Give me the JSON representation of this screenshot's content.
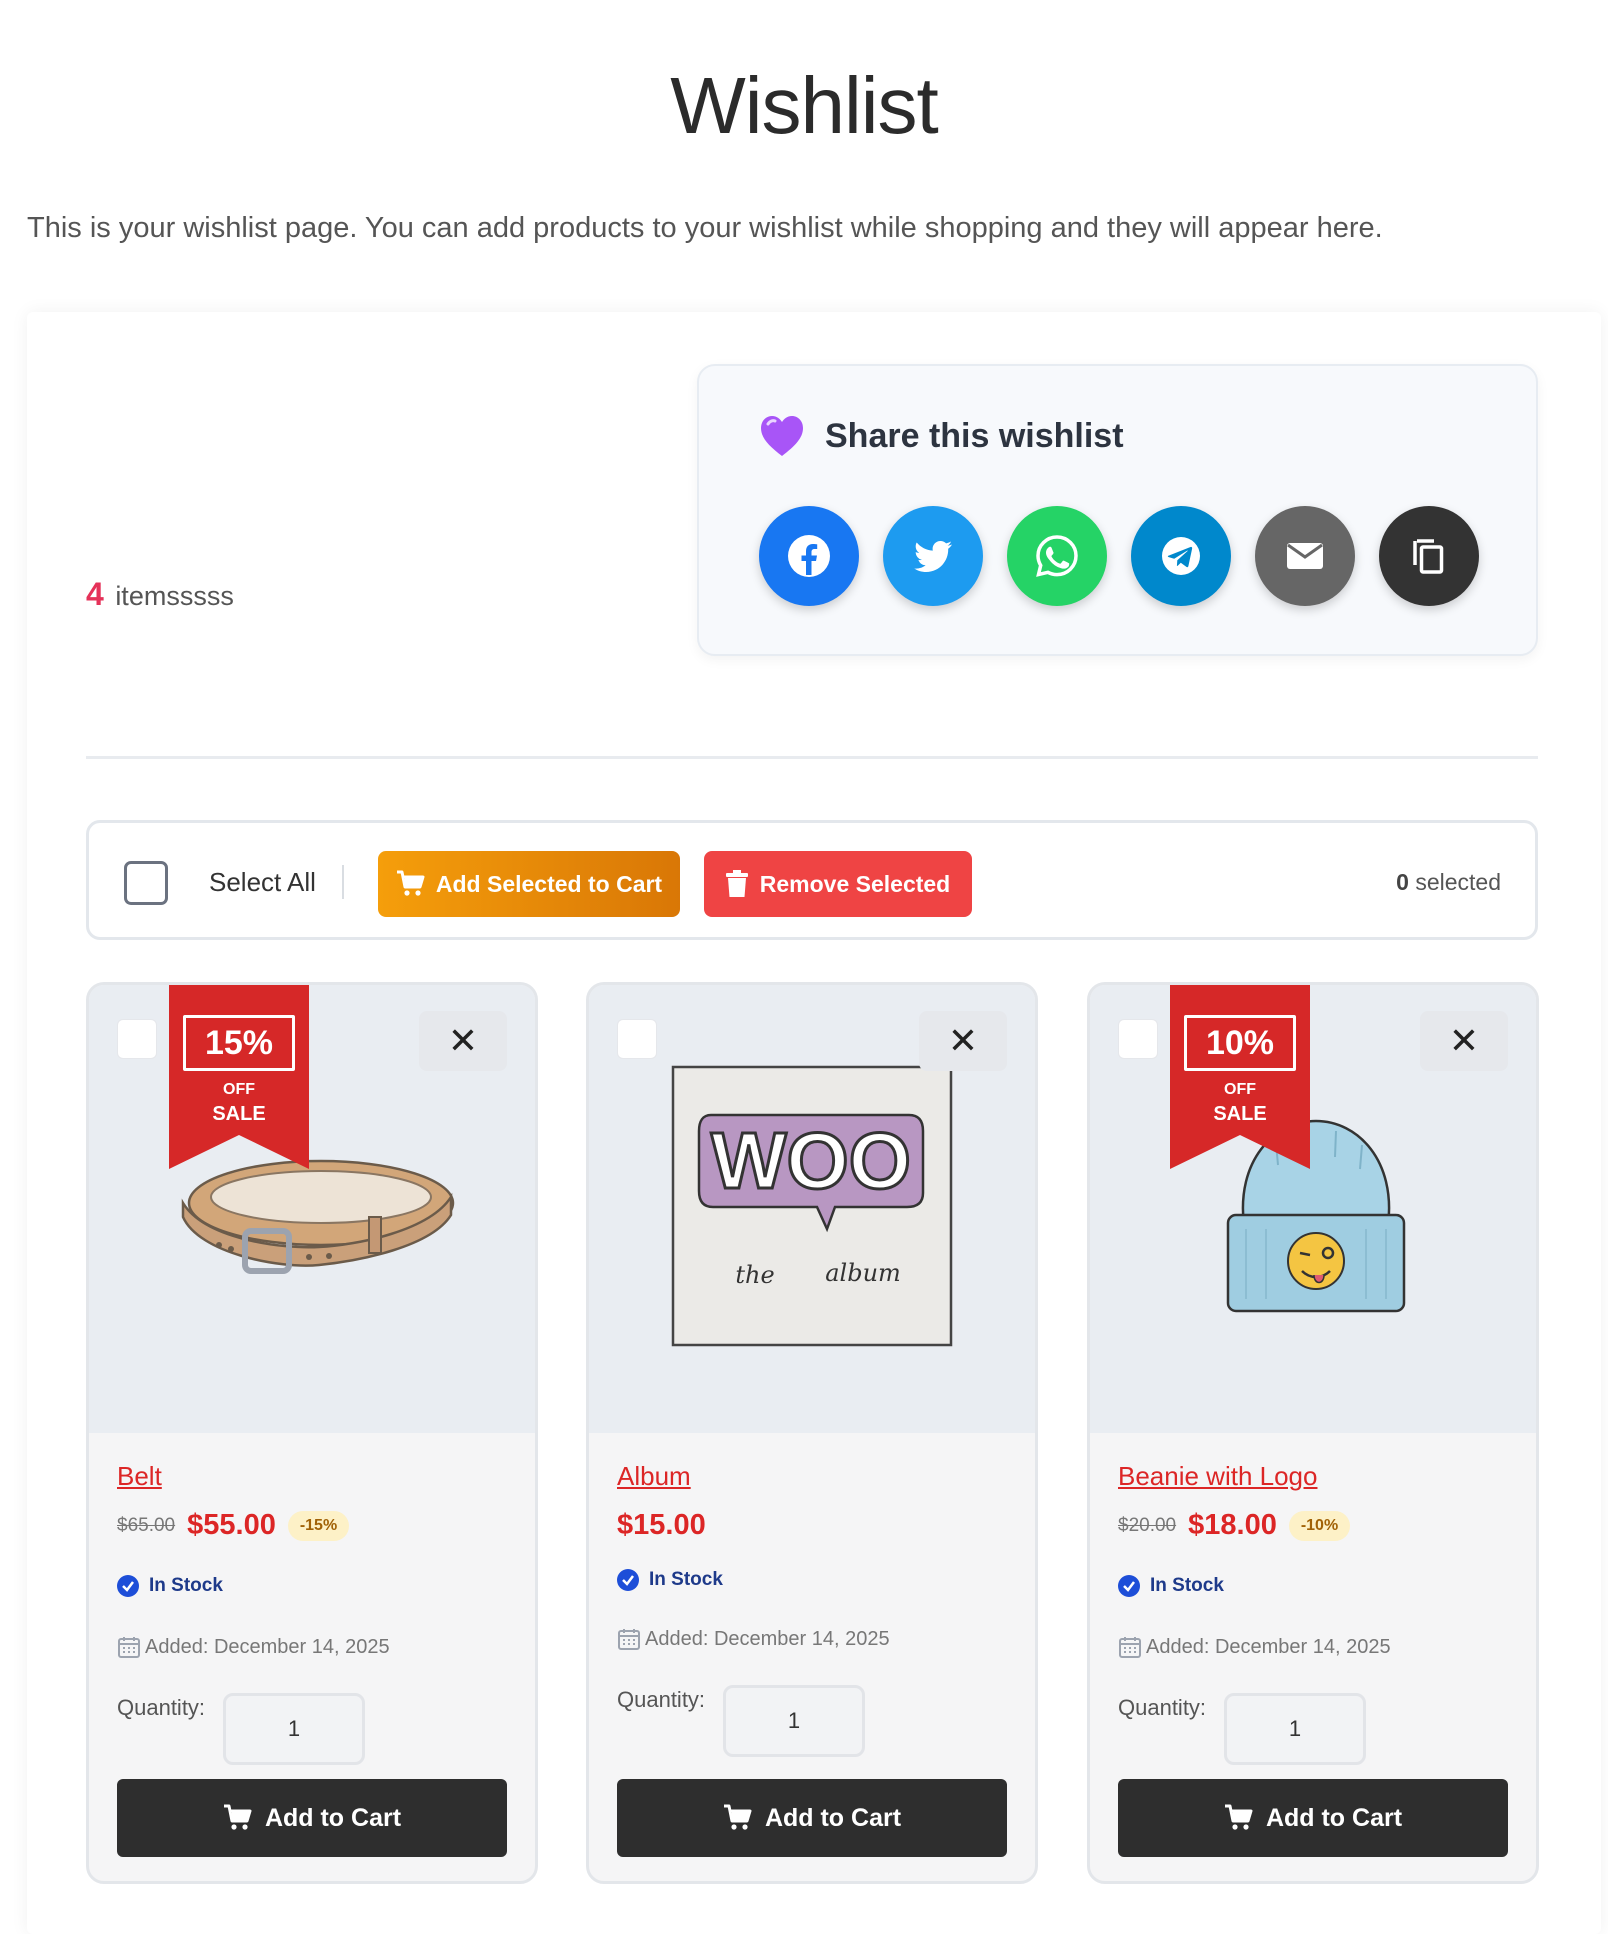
{
  "page": {
    "title": "Wishlist",
    "intro": "This is your wishlist page. You can add products to your wishlist while shopping and they will appear here."
  },
  "summary": {
    "count": "4",
    "count_label": "itemsssss"
  },
  "share": {
    "title": "Share this wishlist",
    "buttons": [
      {
        "name": "facebook",
        "icon": "facebook-icon",
        "color": "#1877f2"
      },
      {
        "name": "twitter",
        "icon": "twitter-icon",
        "color": "#1d9bf0"
      },
      {
        "name": "whatsapp",
        "icon": "whatsapp-icon",
        "color": "#25d366"
      },
      {
        "name": "telegram",
        "icon": "telegram-icon",
        "color": "#0088cc"
      },
      {
        "name": "email",
        "icon": "mail-icon",
        "color": "#666666"
      },
      {
        "name": "copy",
        "icon": "copy-icon",
        "color": "#333333"
      }
    ]
  },
  "toolbar": {
    "select_all": "Select All",
    "add_selected": "Add Selected to Cart",
    "remove_selected": "Remove Selected",
    "selected_count": "0",
    "selected_label": "selected"
  },
  "products": [
    {
      "name": "Belt",
      "old_price": "$65.00",
      "price": "$55.00",
      "discount": "-15%",
      "ribbon_pct": "15%",
      "ribbon_off": "OFF",
      "ribbon_sale": "SALE",
      "stock": "In Stock",
      "added": "Added: December 14, 2025",
      "qty_label": "Quantity:",
      "qty": "1",
      "cart_label": "Add to Cart"
    },
    {
      "name": "Album",
      "price": "$15.00",
      "stock": "In Stock",
      "added": "Added: December 14, 2025",
      "qty_label": "Quantity:",
      "qty": "1",
      "cart_label": "Add to Cart",
      "art_text_main": "WOO",
      "art_text_left": "the",
      "art_text_right": "album"
    },
    {
      "name": "Beanie with Logo",
      "old_price": "$20.00",
      "price": "$18.00",
      "discount": "-10%",
      "ribbon_pct": "10%",
      "ribbon_off": "OFF",
      "ribbon_sale": "SALE",
      "stock": "In Stock",
      "added": "Added: December 14, 2025",
      "qty_label": "Quantity:",
      "qty": "1",
      "cart_label": "Add to Cart"
    }
  ],
  "colors": {
    "accent_red": "#dc2626",
    "orange_button": "#f59e0b",
    "remove_button": "#ef4444",
    "dark_button": "#2e2e2e",
    "ribbon_red": "#d62828"
  }
}
